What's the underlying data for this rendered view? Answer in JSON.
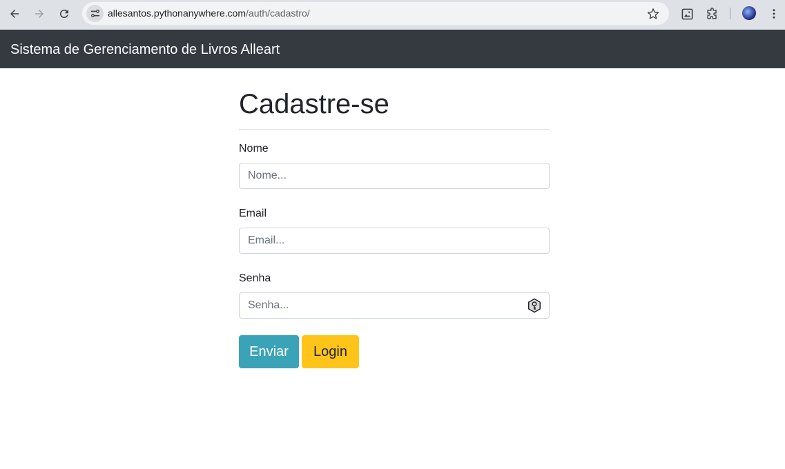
{
  "browser": {
    "url_host": "allesantos.pythonanywhere.com",
    "url_path": "/auth/cadastro/"
  },
  "navbar": {
    "brand": "Sistema de Gerenciamento de Livros Alleart"
  },
  "form": {
    "title": "Cadastre-se",
    "fields": [
      {
        "label": "Nome",
        "placeholder": "Nome...",
        "value": ""
      },
      {
        "label": "Email",
        "placeholder": "Email...",
        "value": ""
      },
      {
        "label": "Senha",
        "placeholder": "Senha...",
        "value": ""
      }
    ],
    "buttons": {
      "send": "Enviar",
      "login": "Login"
    }
  },
  "colors": {
    "navbar_bg": "#343a40",
    "send_button": "#3aa3b8",
    "login_button": "#ffc41a"
  }
}
